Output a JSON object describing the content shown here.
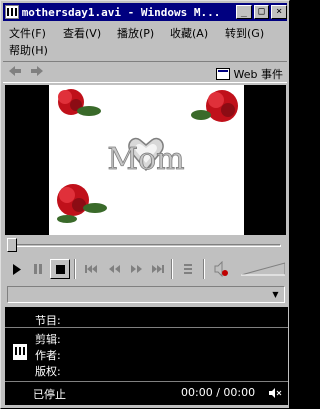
{
  "window": {
    "title": "mothersday1.avi - Windows M..."
  },
  "menu": {
    "file": "文件(F)",
    "view": "查看(V)",
    "play": "播放(P)",
    "favorites": "收藏(A)",
    "goto": "转到(G)",
    "help": "帮助(H)"
  },
  "navbar": {
    "web_events": "Web 事件"
  },
  "video": {
    "overlay_text": "Mom"
  },
  "info": {
    "program_label": "节目:",
    "clip_label": "剪辑:",
    "author_label": "作者:",
    "copyright_label": "版权:",
    "status": "已停止",
    "time": "00:00 / 00:00"
  },
  "icons": {
    "back": "back-arrow-icon",
    "forward": "forward-arrow-icon",
    "play": "play-icon",
    "pause": "pause-icon",
    "stop": "stop-icon",
    "mute": "speaker-mute-icon"
  }
}
